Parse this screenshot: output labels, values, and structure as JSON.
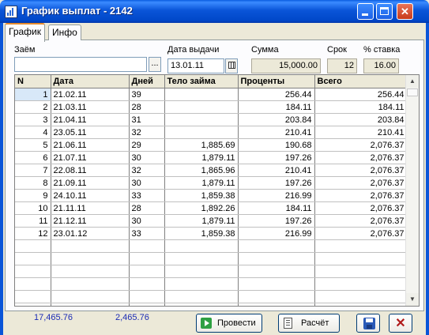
{
  "window": {
    "title": "График выплат - 2142"
  },
  "tabs": [
    {
      "label": "График"
    },
    {
      "label": "Инфо"
    }
  ],
  "form": {
    "loan_label": "Заём",
    "loan_value": "",
    "loan_browse": "...",
    "date_label": "Дата выдачи",
    "date_value": "13.01.11",
    "sum_label": "Сумма",
    "sum_value": "15,000.00",
    "term_label": "Срок",
    "term_value": "12",
    "rate_label": "% ставка",
    "rate_value": "16.00"
  },
  "table": {
    "columns": [
      "N",
      "Дата",
      "Дней",
      "Тело займа",
      "Проценты",
      "Всего"
    ],
    "rows": [
      [
        "1",
        "21.02.11",
        "39",
        "",
        "256.44",
        "256.44"
      ],
      [
        "2",
        "21.03.11",
        "28",
        "",
        "184.11",
        "184.11"
      ],
      [
        "3",
        "21.04.11",
        "31",
        "",
        "203.84",
        "203.84"
      ],
      [
        "4",
        "23.05.11",
        "32",
        "",
        "210.41",
        "210.41"
      ],
      [
        "5",
        "21.06.11",
        "29",
        "1,885.69",
        "190.68",
        "2,076.37"
      ],
      [
        "6",
        "21.07.11",
        "30",
        "1,879.11",
        "197.26",
        "2,076.37"
      ],
      [
        "7",
        "22.08.11",
        "32",
        "1,865.96",
        "210.41",
        "2,076.37"
      ],
      [
        "8",
        "21.09.11",
        "30",
        "1,879.11",
        "197.26",
        "2,076.37"
      ],
      [
        "9",
        "24.10.11",
        "33",
        "1,859.38",
        "216.99",
        "2,076.37"
      ],
      [
        "10",
        "21.11.11",
        "28",
        "1,892.26",
        "184.11",
        "2,076.37"
      ],
      [
        "11",
        "21.12.11",
        "30",
        "1,879.11",
        "197.26",
        "2,076.37"
      ],
      [
        "12",
        "23.01.12",
        "33",
        "1,859.38",
        "216.99",
        "2,076.37"
      ]
    ]
  },
  "totals": {
    "total_all": "17,465.76",
    "total_interest": "2,465.76"
  },
  "buttons": {
    "post_label": "Провести",
    "calc_label": "Расчёт"
  },
  "colors": {
    "titlebar": "#0a55d8",
    "totals_text": "#1a2bb5",
    "selected_cell": "#d8e8f8"
  }
}
